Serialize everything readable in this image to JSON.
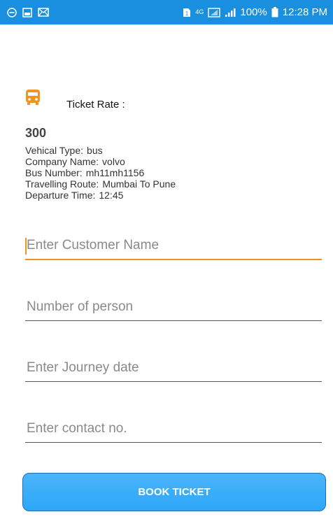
{
  "status_bar": {
    "left_icons": [
      "minus-circle-icon",
      "image-icon",
      "mail-icon"
    ],
    "right_icons": [
      "sim-icon",
      "4g-icon",
      "network-icon",
      "signal-icon",
      "battery-icon"
    ],
    "network": "4G",
    "battery_text": "100%",
    "time": "12:28 PM"
  },
  "ticket": {
    "icon": "bus-icon",
    "rate_label": "Ticket Rate :",
    "price": "300",
    "details": [
      {
        "label": "Vehical Type:",
        "value": "bus"
      },
      {
        "label": "Company Name:",
        "value": "volvo"
      },
      {
        "label": "Bus Number:",
        "value": "mh11mh1156"
      },
      {
        "label": "Travelling Route:",
        "value": "Mumbai To Pune"
      },
      {
        "label": "Departure Time:",
        "value": "12:45"
      }
    ]
  },
  "form": {
    "customer_name": {
      "placeholder": "Enter Customer Name",
      "value": ""
    },
    "persons": {
      "placeholder": "Number of person",
      "value": ""
    },
    "journey_date": {
      "placeholder": "Enter Journey date",
      "value": ""
    },
    "contact": {
      "placeholder": "Enter contact no.",
      "value": ""
    }
  },
  "book_button": "BOOK TICKET",
  "colors": {
    "status_bar": "#1a8fe0",
    "accent": "#f0941e",
    "button": "#3aaef9"
  }
}
